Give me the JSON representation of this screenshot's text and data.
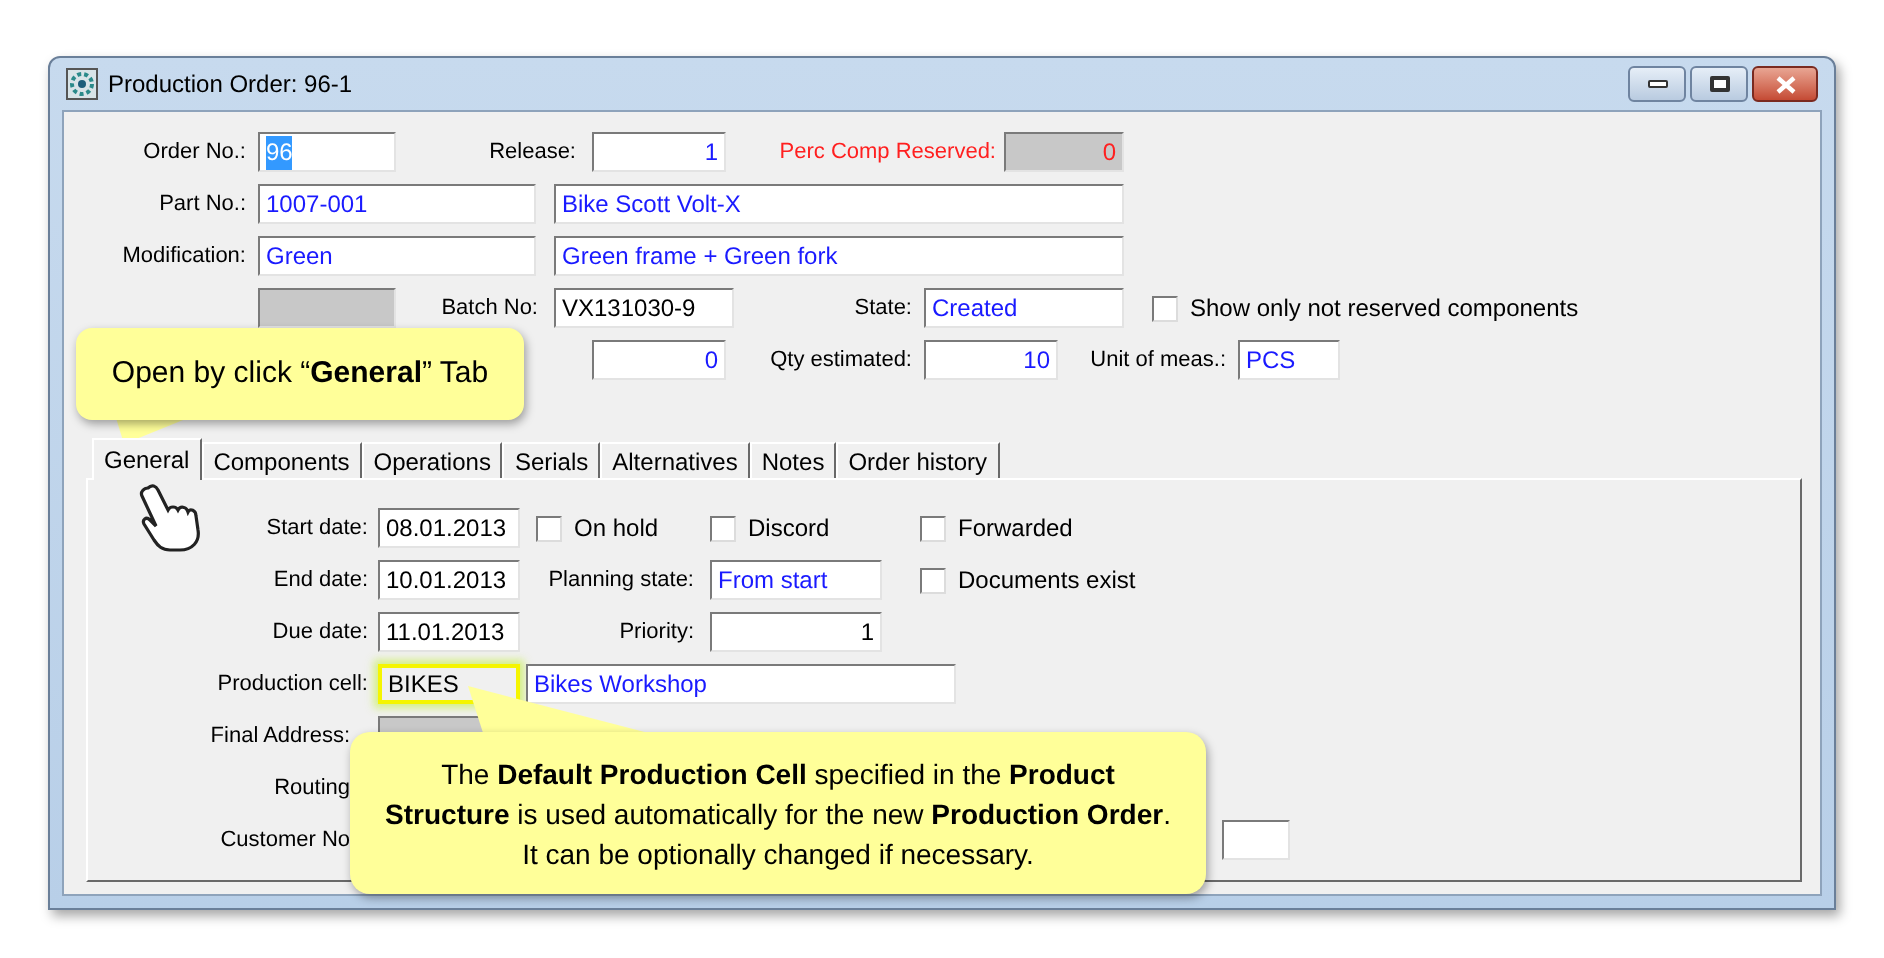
{
  "window": {
    "title": "Production Order: 96-1"
  },
  "order_no": {
    "label": "Order No.:",
    "value": "96",
    "selected": true
  },
  "release": {
    "label": "Release:",
    "value": "1"
  },
  "perc_comp_reserved": {
    "label": "Perc Comp Reserved:",
    "value": "0",
    "disabled": true
  },
  "part_no": {
    "label": "Part No.:",
    "value": "1007-001",
    "description": "Bike Scott Volt-X"
  },
  "modification": {
    "label": "Modification:",
    "value": "Green",
    "description": "Green frame + Green fork"
  },
  "version": {
    "disabled": true
  },
  "batch_no": {
    "label": "Batch No:",
    "value": "VX131030-9"
  },
  "state": {
    "label": "State:",
    "value": "Created"
  },
  "show_only_not_reserved": {
    "label": "Show only not reserved components",
    "checked": false
  },
  "qty_ready": {
    "value": "0"
  },
  "qty_estimated": {
    "label": "Qty estimated:",
    "value": "10"
  },
  "unit_of_meas": {
    "label": "Unit of meas.:",
    "value": "PCS"
  },
  "tabs": [
    {
      "label": "General",
      "selected": true
    },
    {
      "label": "Components",
      "selected": false
    },
    {
      "label": "Operations",
      "selected": false
    },
    {
      "label": "Serials",
      "selected": false
    },
    {
      "label": "Alternatives",
      "selected": false
    },
    {
      "label": "Notes",
      "selected": false
    },
    {
      "label": "Order history",
      "selected": false
    }
  ],
  "general": {
    "start_date": {
      "label": "Start date:",
      "value": "08.01.2013"
    },
    "end_date": {
      "label": "End date:",
      "value": "10.01.2013"
    },
    "due_date": {
      "label": "Due date:",
      "value": "11.01.2013"
    },
    "on_hold": {
      "label": "On hold",
      "checked": false
    },
    "discord": {
      "label": "Discord",
      "checked": false
    },
    "forwarded": {
      "label": "Forwarded",
      "checked": false
    },
    "documents_exist": {
      "label": "Documents exist",
      "checked": false
    },
    "planning_state": {
      "label": "Planning state:",
      "value": "From start"
    },
    "priority": {
      "label": "Priority:",
      "value": "1"
    },
    "production_cell": {
      "label": "Production cell:",
      "value": "BIKES",
      "highlighted": true,
      "description": "Bikes Workshop"
    },
    "final_address": {
      "label": "Final Address:"
    },
    "routing": {
      "label": "Routing"
    },
    "customer_no": {
      "label": "Customer No"
    }
  },
  "callouts": [
    {
      "text": "Open by click “**General**” Tab"
    },
    {
      "text": "The **Default Production  Cell** specified in the **Product Structure** is used automatically for the new **Production Order**. It can be optionally changed if necessary."
    }
  ]
}
